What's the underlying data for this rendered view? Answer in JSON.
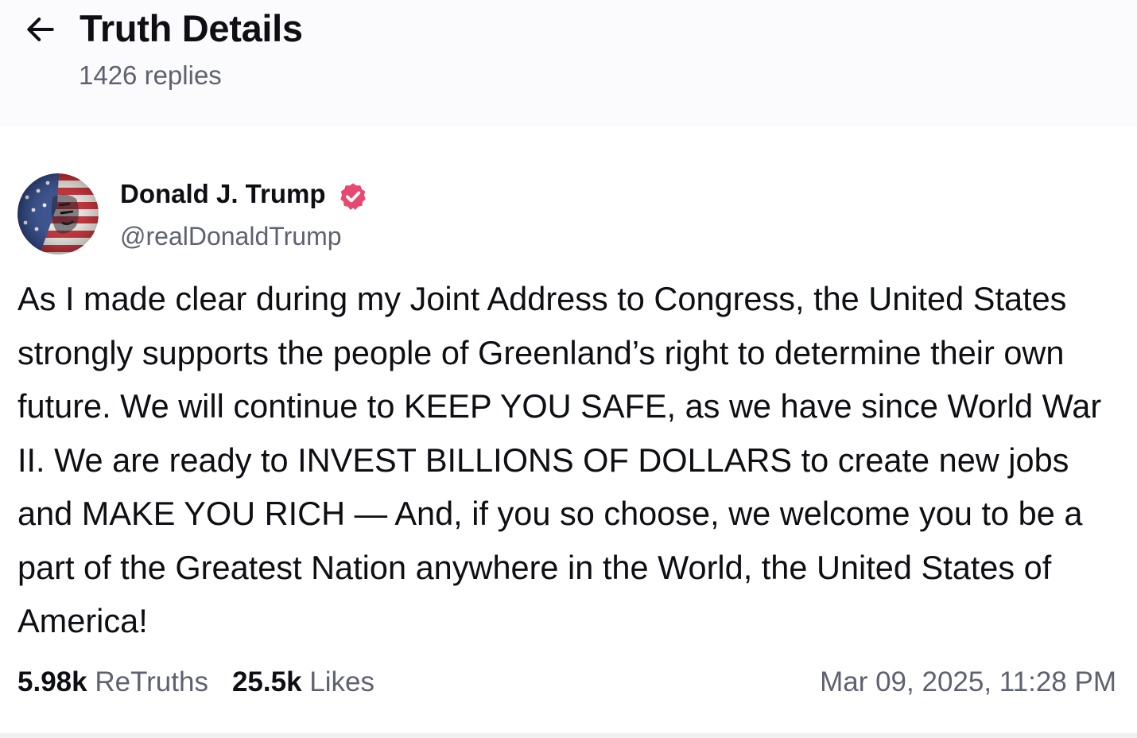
{
  "header": {
    "back_icon": "arrow-left-icon",
    "title": "Truth Details",
    "replies": "1426 replies"
  },
  "post": {
    "author": {
      "name": "Donald J. Trump",
      "handle": "@realDonaldTrump",
      "verified_icon": "verified-badge-icon",
      "verified_color": "#e8486f"
    },
    "text": "As I made clear during my Joint Address to Congress, the United States strongly supports the people of Greenland’s right to determine their own future. We will continue to KEEP YOU SAFE, as we have since World War II. We are ready to INVEST BILLIONS OF DOLLARS to create new jobs and MAKE YOU RICH — And, if you so choose, we welcome you to be a part of the Greatest Nation anywhere in the World, the United States of America!",
    "stats": {
      "retruths_count": "5.98k",
      "retruths_label": "ReTruths",
      "likes_count": "25.5k",
      "likes_label": "Likes"
    },
    "timestamp": "Mar 09, 2025, 11:28 PM"
  }
}
